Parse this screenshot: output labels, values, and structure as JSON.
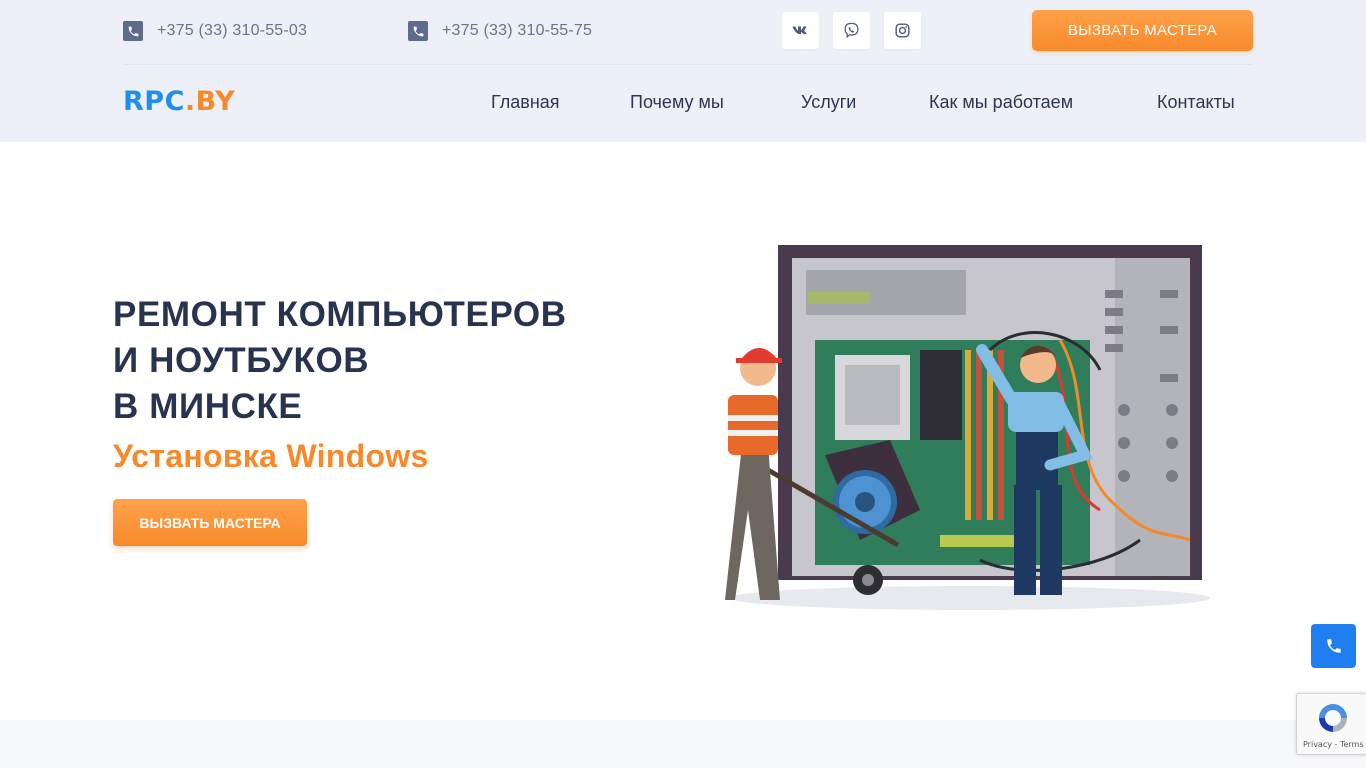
{
  "header": {
    "phones": [
      "+375 (33) 310-55-03",
      "+375 (33) 310-55-75"
    ],
    "social_icons": [
      "vk-icon",
      "viber-icon",
      "instagram-icon"
    ],
    "cta_label": "ВЫЗВАТЬ МАСТЕРА",
    "logo": {
      "part1": "RPC",
      "part2": ".BY"
    },
    "nav": [
      "Главная",
      "Почему мы",
      "Услуги",
      "Как мы работаем",
      "Контакты"
    ]
  },
  "hero": {
    "title_lines": [
      "РЕМОНТ КОМПЬЮТЕРОВ",
      "И НОУТБУКОВ",
      "В МИНСКЕ"
    ],
    "subtitle": "Установка Windows",
    "cta_label": "ВЫЗВАТЬ МАСТЕРА"
  },
  "recaptcha": {
    "terms": "Privacy - Terms"
  },
  "colors": {
    "accent_orange": "#f7892b",
    "brand_blue": "#1f8ef1",
    "header_bg": "#edf0f7",
    "title_dark": "#28334f"
  }
}
